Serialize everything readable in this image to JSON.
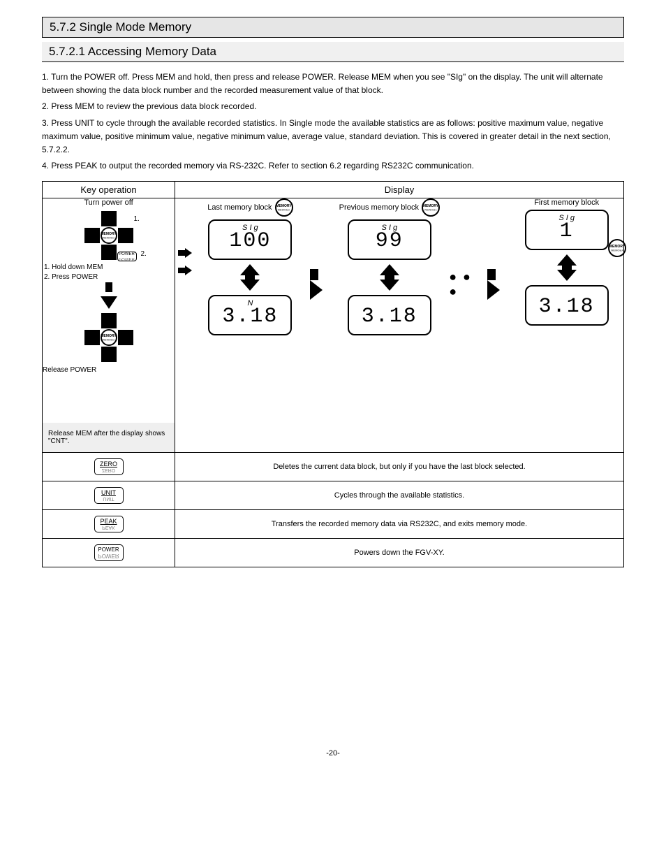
{
  "section": {
    "number_title": "5.7.2 Single Mode Memory"
  },
  "subsection": {
    "number_title": "5.7.2.1 Accessing Memory Data"
  },
  "paragraphs": {
    "p1": "1. Turn the POWER off. Press MEM and hold, then press and release POWER.  Release MEM when you see \"SIg\" on the display.  The unit will alternate between showing the data block number and the recorded measurement value of that block.",
    "p2": "2. Press MEM to review the previous data block recorded.",
    "p3": "3. Press UNIT to cycle through the available recorded statistics.  In Single mode the available statistics are as follows:  positive maximum value, negative maximum value, positive minimum value, negative minimum value, average value, standard deviation. This is covered in greater detail in the next section, 5.7.2.2.",
    "p4": "4. Press PEAK to output the recorded memory via RS-232C.  Refer to section 6.2 regarding RS232C communication."
  },
  "table_headers": {
    "key_op": "Key operation",
    "display": "Display"
  },
  "key_ops": {
    "turn_off": "Turn power off",
    "step1": "1. Hold down MEM",
    "step2": "2. Press POWER",
    "release_power": "Release POWER",
    "release_mem_note": "Release MEM after the display shows \"CNT\".",
    "num1": "1.",
    "num2": "2.",
    "power_label": "POWER",
    "memory_label": "MEMORY"
  },
  "display": {
    "last_block": "Last memory block",
    "prev_block": "Previous memory block",
    "first_block": "First memory block",
    "sig_unit": "S I g",
    "n_unit": "N",
    "val100": "100",
    "val99": "99",
    "val1": "1",
    "val318": "3.18",
    "dots": "● ● ●",
    "memory_label": "MEMORY"
  },
  "func_rows": {
    "zero": {
      "key": "ZERO",
      "desc": "Deletes the current data block, but only if you have the last block selected."
    },
    "unit": {
      "key": "UNIT",
      "desc": "Cycles through the available statistics."
    },
    "peak": {
      "key": "PEAK",
      "desc": "Transfers the recorded memory data via RS232C, and exits memory mode."
    },
    "power": {
      "key": "POWER",
      "desc": "Powers down the FGV-XY."
    }
  },
  "page_number": "-20-"
}
